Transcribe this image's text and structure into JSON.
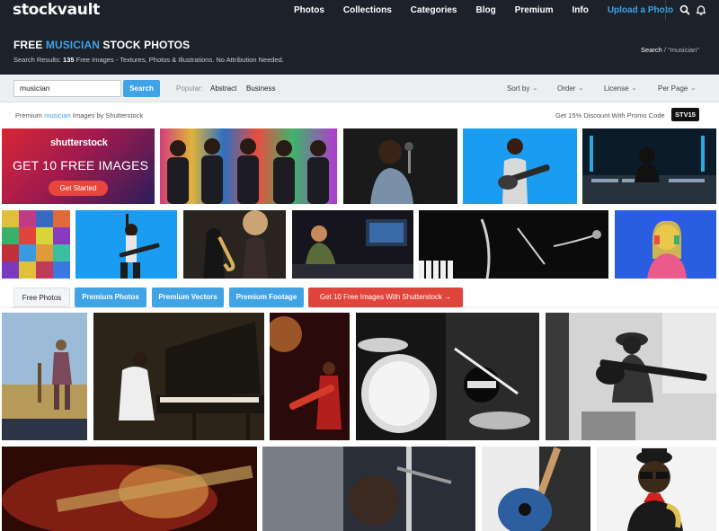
{
  "nav": {
    "logo": "stockvault",
    "links": [
      "Photos",
      "Collections",
      "Categories",
      "Blog",
      "Premium",
      "Info",
      "Upload a Photo"
    ],
    "icons": [
      "search-icon",
      "bell-icon"
    ]
  },
  "hero": {
    "title_pre": "FREE ",
    "title_highlight": "MUSICIAN",
    "title_post": " STOCK PHOTOS",
    "subtitle_pre": "Search Results: ",
    "subtitle_count": "135",
    "subtitle_post": " Free Images - Textures, Photos & Illustrations. No Attribution Needed.",
    "breadcrumb_root": "Search",
    "breadcrumb_sep": " / ",
    "breadcrumb_query": "\"musician\""
  },
  "search": {
    "value": "musician",
    "button": "Search",
    "popular_label": "Popular:",
    "popular": [
      "Abstract",
      "Business"
    ],
    "dropdowns": [
      "Sort by",
      "Order",
      "License",
      "Per Page"
    ]
  },
  "premium": {
    "label_pre": "Premium ",
    "label_highlight": "musician",
    "label_post": " Images by Shutterstock",
    "promo_text": "Get 15% Discount With Promo Code",
    "promo_code": "STV15"
  },
  "ad": {
    "logo": "shutterstock",
    "headline": "GET 10 FREE IMAGES",
    "button": "Get Started"
  },
  "tabs": [
    "Free Photos",
    "Premium Photos",
    "Premium Vectors",
    "Premium Footage",
    "Get 10 Free Images With Shutterstock →"
  ],
  "colors": {
    "nav_bg": "#1d212a",
    "accent": "#3fa3e6",
    "ad_red": "#e0453b"
  }
}
